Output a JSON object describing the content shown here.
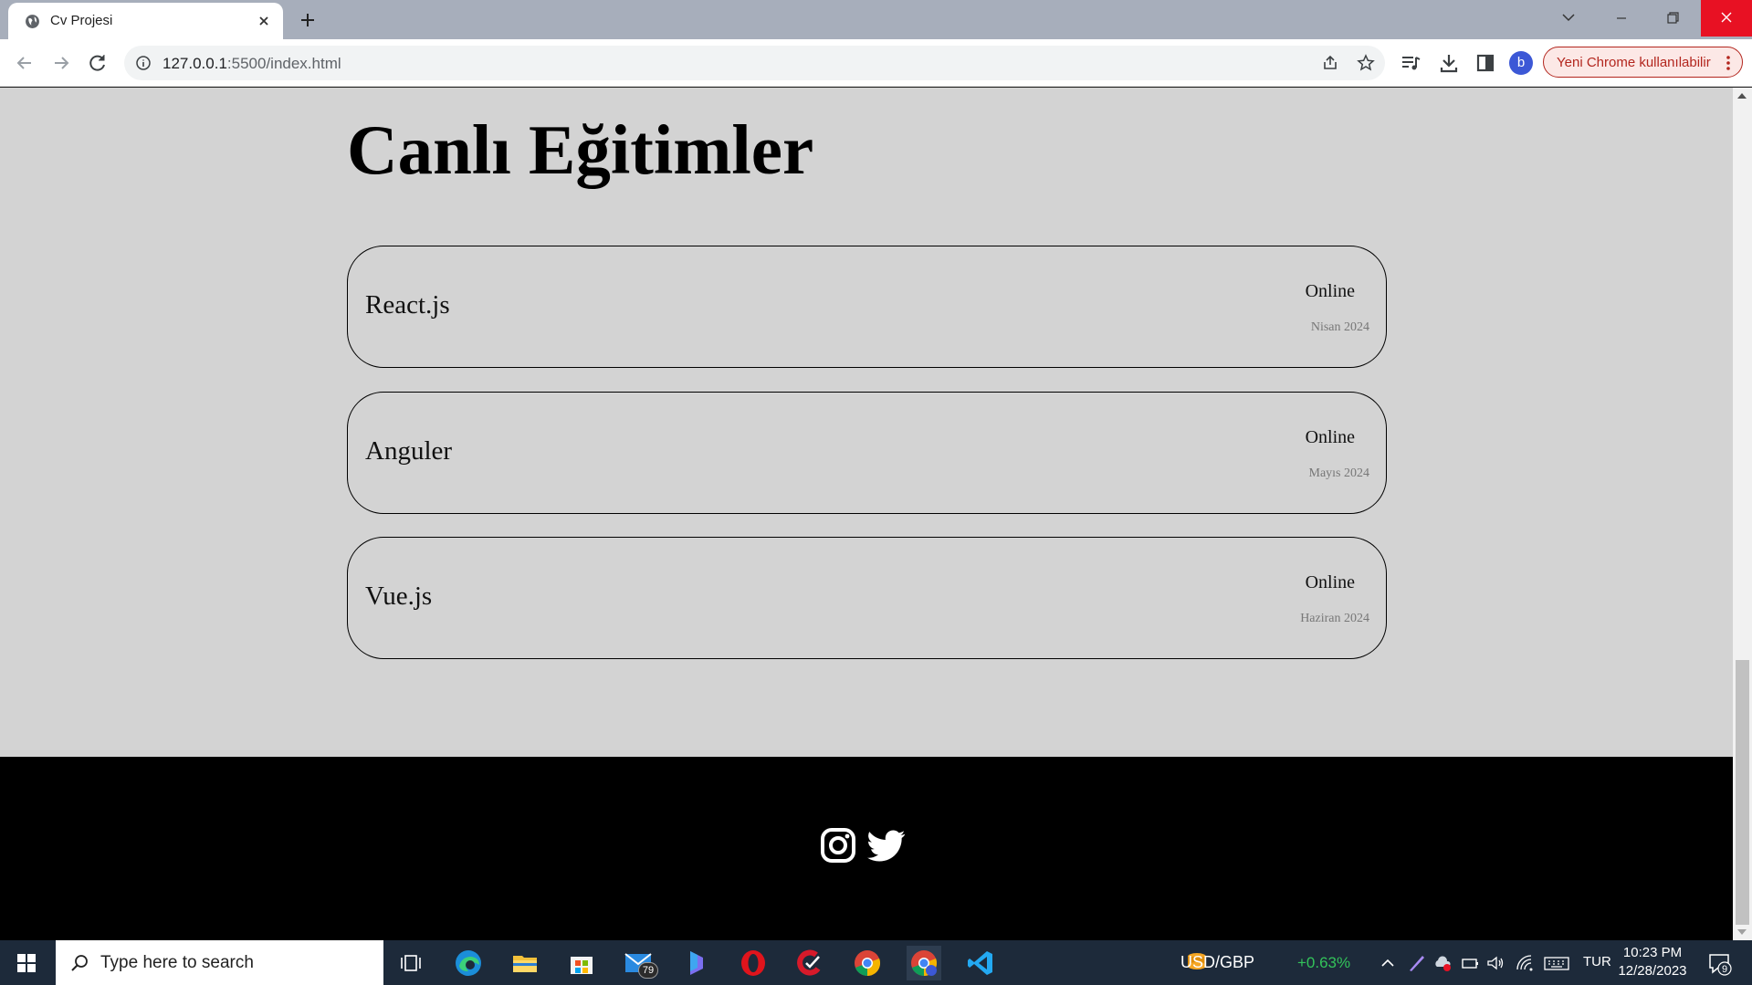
{
  "browser": {
    "tab_title": "Cv Projesi",
    "url_host": "127.0.0.1",
    "url_path": ":5500/index.html",
    "profile_initial": "b",
    "update_label": "Yeni Chrome kullanılabilir"
  },
  "page": {
    "heading": "Canlı Eğitimler",
    "courses": [
      {
        "name": "React.js",
        "mode": "Online",
        "date": "Nisan 2024"
      },
      {
        "name": "Anguler",
        "mode": "Online",
        "date": "Mayıs 2024"
      },
      {
        "name": "Vue.js",
        "mode": "Online",
        "date": "Haziran 2024"
      }
    ],
    "footer_icons": [
      "instagram-icon",
      "twitter-icon"
    ]
  },
  "taskbar": {
    "search_placeholder": "Type here to search",
    "mail_badge": "79",
    "ticker_label": "USD/GBP",
    "ticker_change": "+0.63%",
    "language": "TUR",
    "time": "10:23 PM",
    "date": "12/28/2023",
    "notification_count": "9"
  },
  "colors": {
    "page_background": "#d3d3d3",
    "footer_background": "#000000",
    "close_button": "#e81123",
    "update_accent": "#b3261e",
    "ticker_positive": "#33c35a"
  }
}
